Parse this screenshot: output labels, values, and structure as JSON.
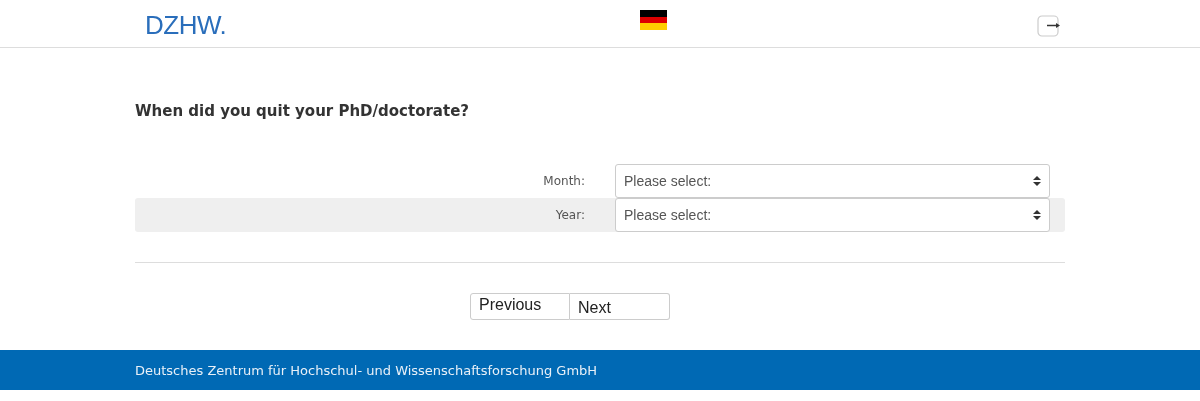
{
  "header": {
    "logo": "DZHW."
  },
  "question": "When did you quit your PhD/doctorate?",
  "fields": [
    {
      "label": "Month:",
      "placeholder": "Please select:"
    },
    {
      "label": "Year:",
      "placeholder": "Please select:"
    }
  ],
  "buttons": [
    "Previous",
    "Next"
  ],
  "footer": "Deutsches Zentrum für Hochschul- und Wissenschaftsforschung GmbH"
}
